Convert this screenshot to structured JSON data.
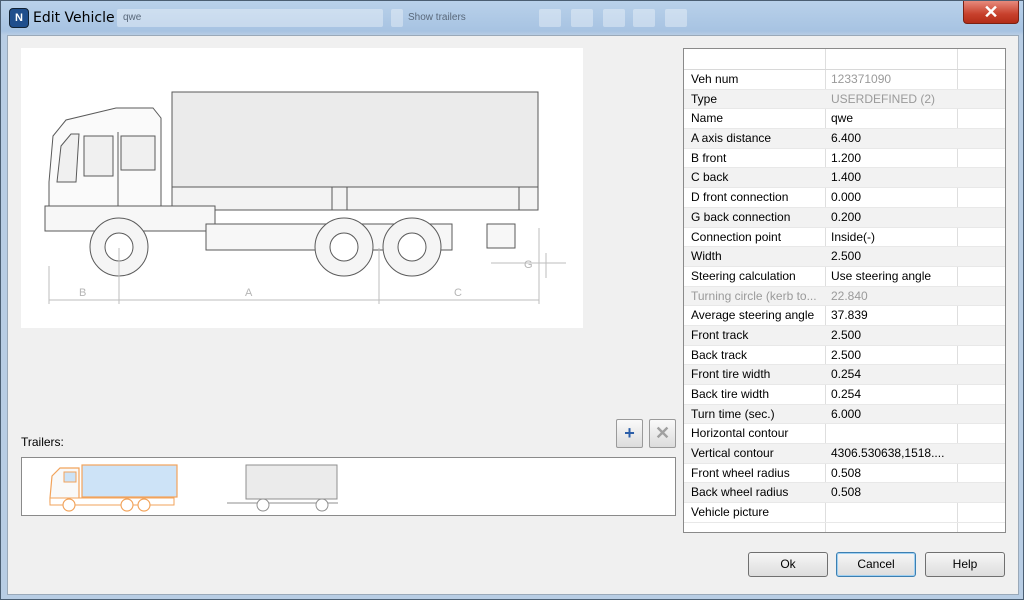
{
  "window": {
    "title": "Edit Vehicle",
    "app_icon": "N"
  },
  "background_toolbar": {
    "dropdown_text": "qwe",
    "checkbox_label": "Show trailers"
  },
  "preview": {
    "dimension_labels": [
      "B",
      "A",
      "C",
      "G"
    ]
  },
  "trailers": {
    "label": "Trailers:",
    "add_icon": "+",
    "delete_icon": "✕"
  },
  "properties": [
    {
      "name": "Veh num",
      "value": "123371090",
      "disabled": true
    },
    {
      "name": "Type",
      "value": "USERDEFINED (2)",
      "disabled": true
    },
    {
      "name": "Name",
      "value": "qwe"
    },
    {
      "name": "A axis distance",
      "value": "6.400"
    },
    {
      "name": "B front",
      "value": "1.200"
    },
    {
      "name": "C back",
      "value": "1.400"
    },
    {
      "name": "D front connection",
      "value": "0.000"
    },
    {
      "name": "G back connection",
      "value": "0.200"
    },
    {
      "name": "Connection point",
      "value": "Inside(-)"
    },
    {
      "name": "Width",
      "value": "2.500"
    },
    {
      "name": "Steering calculation",
      "value": "Use steering angle"
    },
    {
      "name": "Turning circle (kerb to...",
      "value": "22.840",
      "disabled": true
    },
    {
      "name": "Average steering angle",
      "value": "37.839"
    },
    {
      "name": "Front track",
      "value": "2.500"
    },
    {
      "name": "Back track",
      "value": "2.500"
    },
    {
      "name": "Front tire width",
      "value": "0.254"
    },
    {
      "name": "Back tire width",
      "value": "0.254"
    },
    {
      "name": "Turn time (sec.)",
      "value": "6.000"
    },
    {
      "name": "Horizontal contour",
      "value": ""
    },
    {
      "name": "Vertical contour",
      "value": "4306.530638,1518...."
    },
    {
      "name": "Front wheel radius",
      "value": "0.508"
    },
    {
      "name": "Back wheel radius",
      "value": "0.508"
    },
    {
      "name": "Vehicle picture",
      "value": ""
    }
  ],
  "buttons": {
    "ok": "Ok",
    "cancel": "Cancel",
    "help": "Help"
  },
  "colors": {
    "trailer_truck_cab": "#f2a35b",
    "trailer_truck_box": "#cde3f7"
  }
}
